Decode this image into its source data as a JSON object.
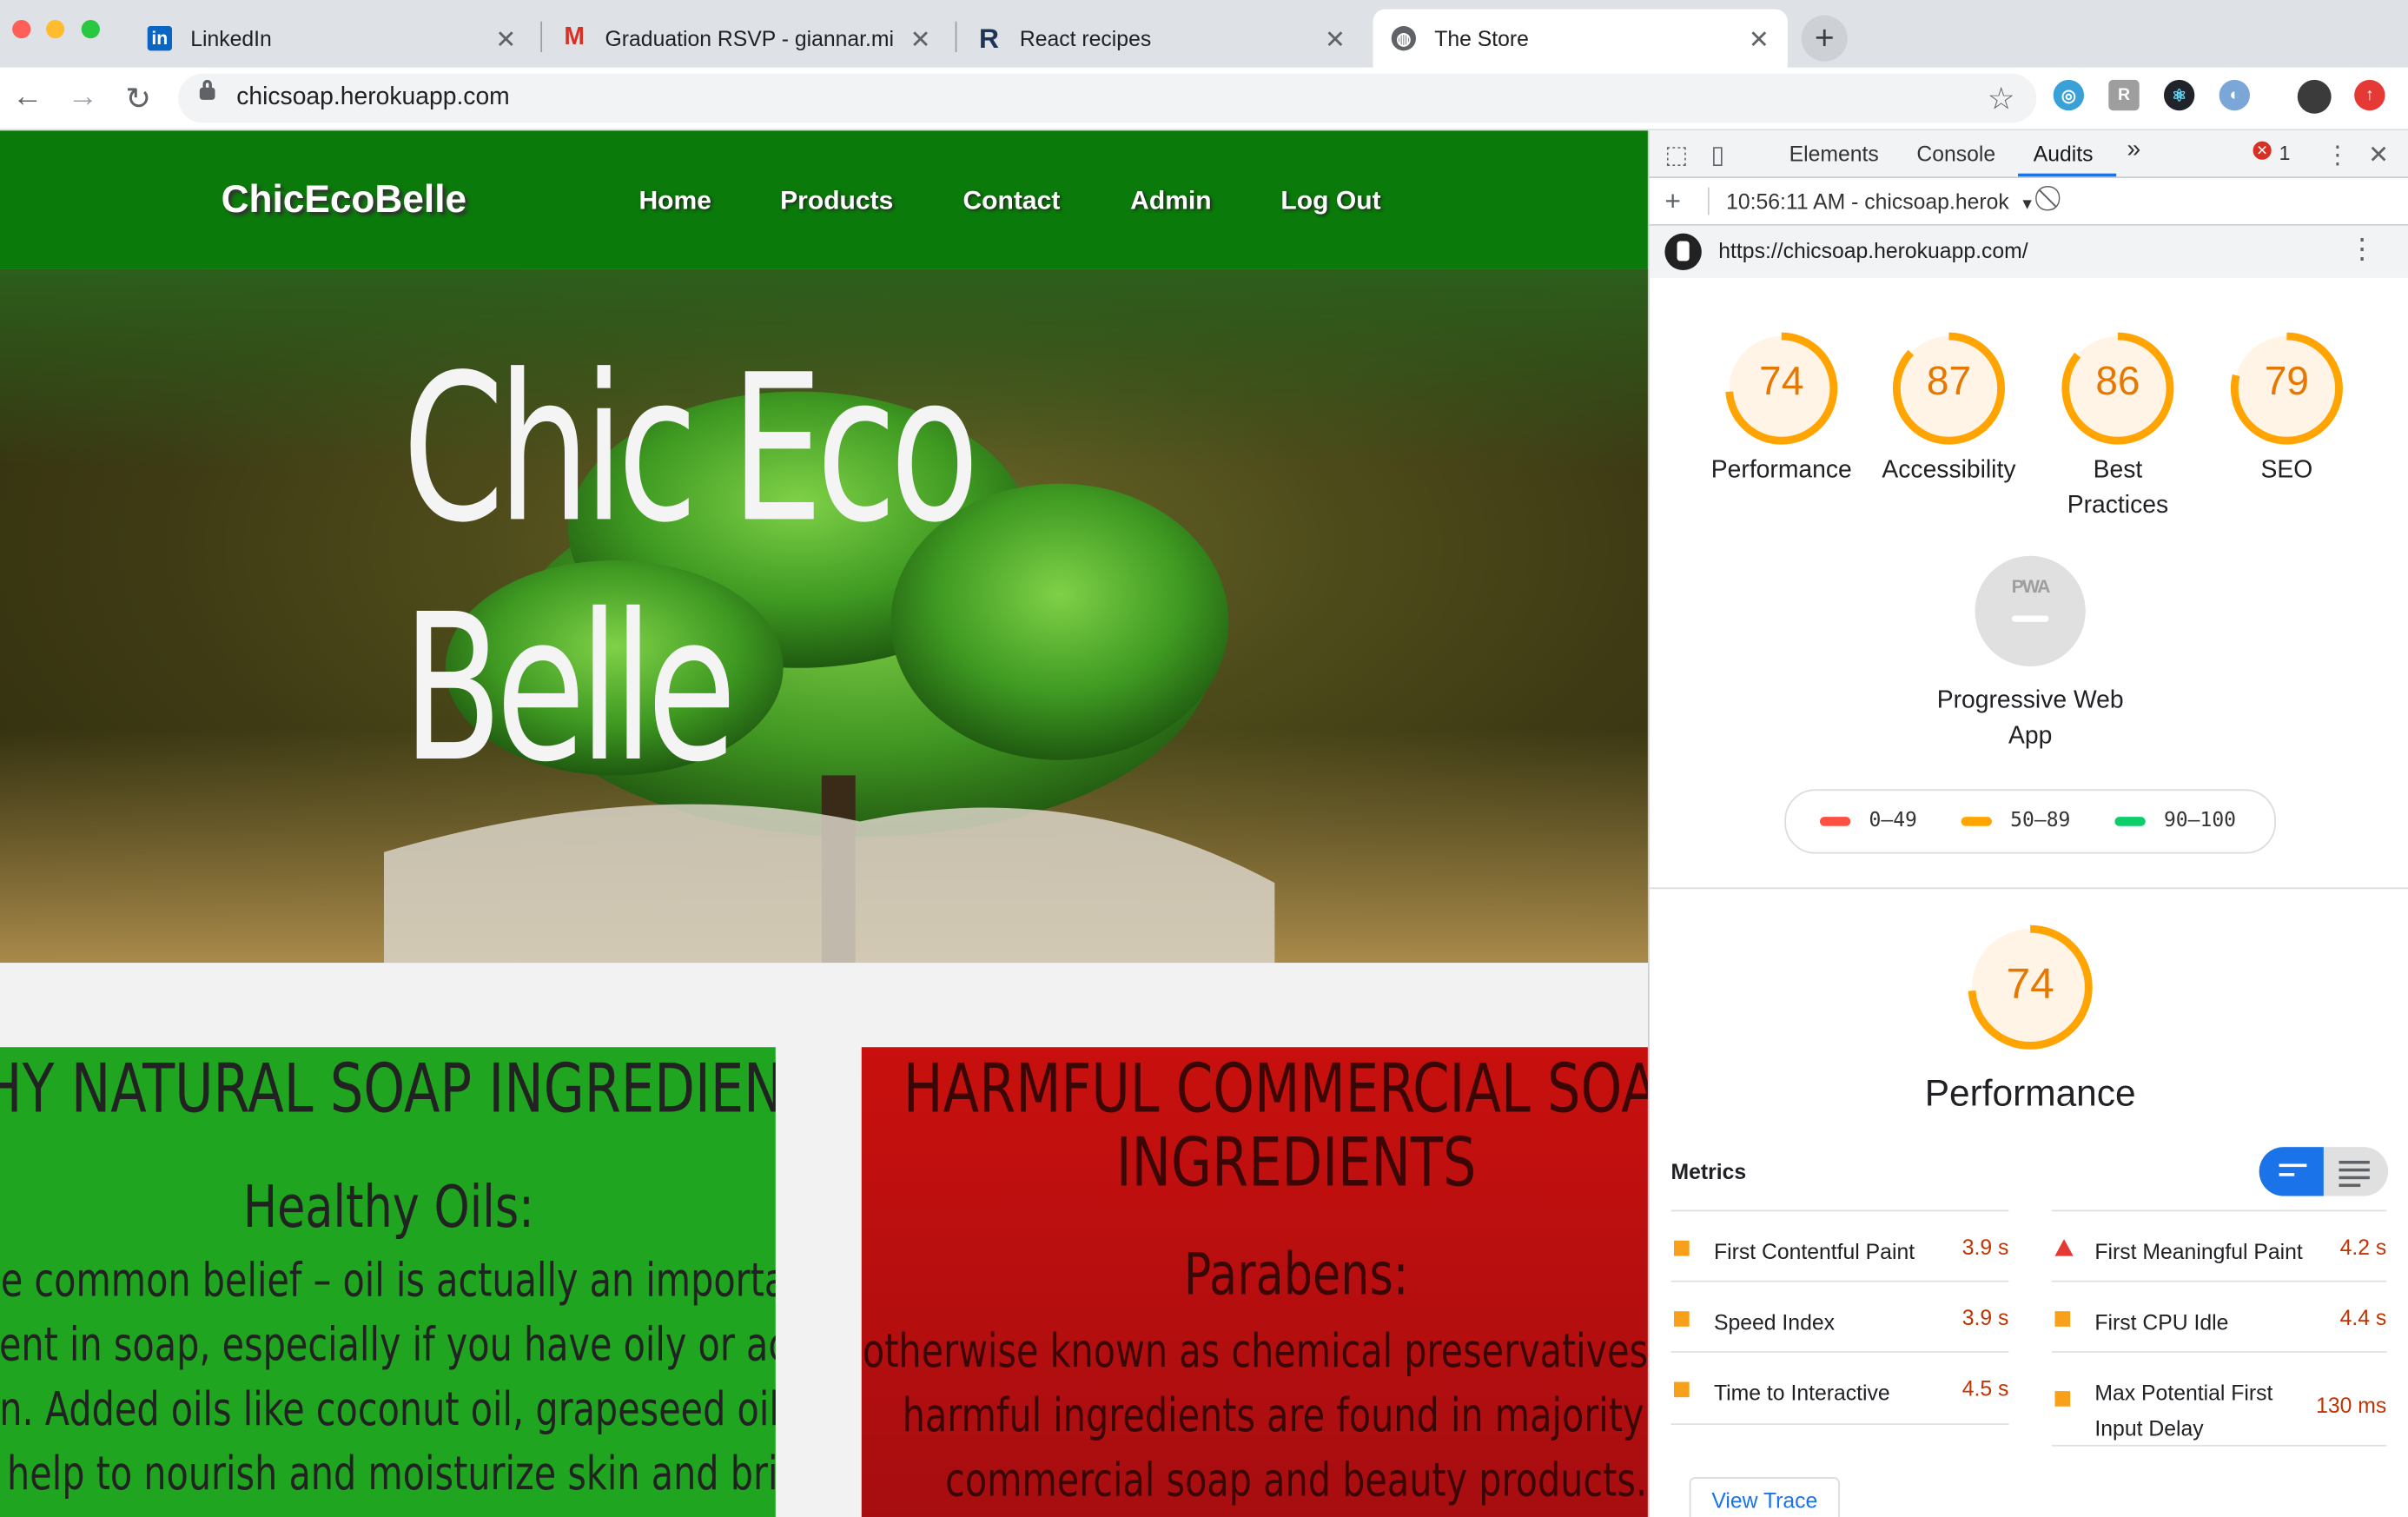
{
  "browser": {
    "tabs": [
      {
        "title": "LinkedIn",
        "icon": "linkedin-icon"
      },
      {
        "title": "Graduation RSVP - giannar.mi",
        "icon": "gmail-icon"
      },
      {
        "title": "React recipes",
        "icon": "react-recipes-icon"
      },
      {
        "title": "The Store",
        "icon": "globe-icon"
      }
    ],
    "url": "chicsoap.herokuapp.com"
  },
  "site": {
    "brand": "ChicEcoBelle",
    "nav": [
      "Home",
      "Products",
      "Contact",
      "Admin",
      "Log Out"
    ],
    "hero_line1": "Chic Eco",
    "hero_line2": "Belle",
    "left_card": {
      "heading": "LTHY NATURAL SOAP INGREDIENTS",
      "subheading": "Healthy Oils:",
      "lines": [
        "pite common belief – oil is actually an important",
        "edient in soap, especially if you have oily or acne",
        " skin. Added oils like coconut oil, grapeseed oil or",
        " oil help to nourish and moisturize skin and bring"
      ]
    },
    "right_card": {
      "heading_line1": "HARMFUL COMMERCIAL SOAP",
      "heading_line2": "INGREDIENTS",
      "subheading": "Parabens:",
      "lines": [
        "otherwise known as chemical preservatives, the",
        "harmful ingredients are found in majority of",
        "commercial soap and beauty products."
      ]
    }
  },
  "devtools": {
    "tabs": [
      "Elements",
      "Console",
      "Audits"
    ],
    "more": "»",
    "error_count": "1",
    "run_label": "10:56:11 AM - chicsoap.herok",
    "audit_url": "https://chicsoap.herokuapp.com/",
    "scores": [
      {
        "label": "Performance",
        "value": 74
      },
      {
        "label": "Accessibility",
        "value": 87
      },
      {
        "label": "Best Practices",
        "value": 86
      },
      {
        "label": "SEO",
        "value": 79
      }
    ],
    "pwa": {
      "badge": "PWA",
      "label": "Progressive Web App"
    },
    "legend": [
      "0–49",
      "50–89",
      "90–100"
    ],
    "colors": {
      "fail": "#ff4e42",
      "average": "#ffa400",
      "pass": "#0cce6b",
      "accent": "#1a73e8"
    },
    "performance": {
      "value": 74,
      "title": "Performance"
    },
    "metrics_heading": "Metrics",
    "metrics_left": [
      {
        "name": "First Contentful Paint",
        "value": "3.9 s"
      },
      {
        "name": "Speed Index",
        "value": "3.9 s"
      },
      {
        "name": "Time to Interactive",
        "value": "4.5 s"
      }
    ],
    "metrics_right": [
      {
        "name": "First Meaningful Paint",
        "value": "4.2 s"
      },
      {
        "name": "First CPU Idle",
        "value": "4.4 s"
      },
      {
        "name": "Max Potential First Input Delay",
        "value": "130 ms"
      }
    ],
    "view_trace": "View Trace"
  }
}
